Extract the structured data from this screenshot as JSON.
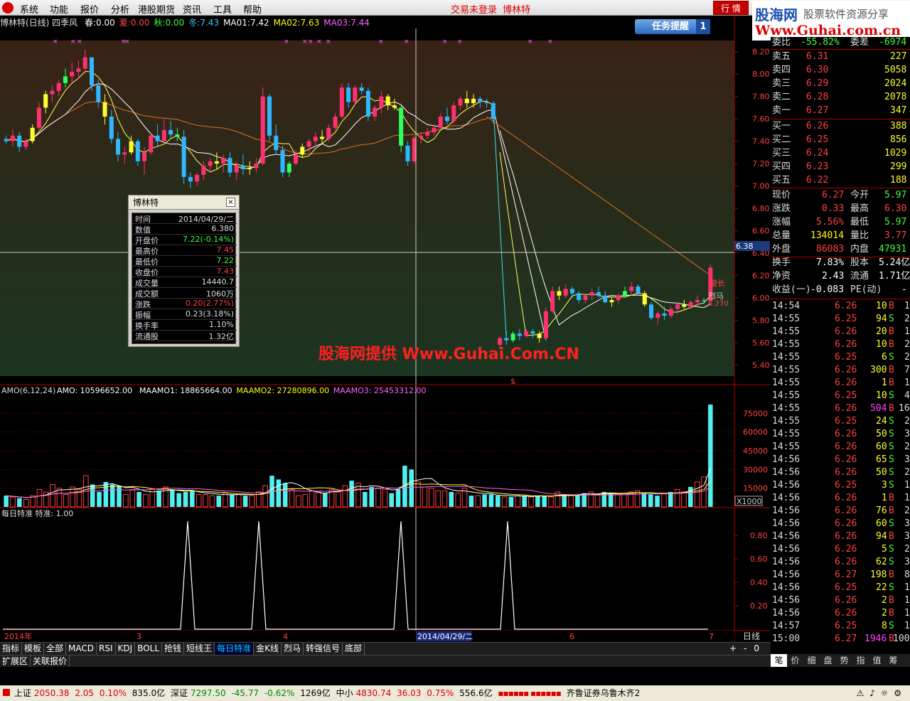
{
  "menubar": {
    "items": [
      "系统",
      "功能",
      "报价",
      "分析",
      "港股期货",
      "资讯",
      "工具",
      "帮助"
    ],
    "trade_status": "交易未登录",
    "stock_name": "博林特",
    "quote_button": "行 情"
  },
  "ad": {
    "site_cn": "股海网",
    "tagline": "股票软件资源分享",
    "url": "Www.Guhai.com.cn"
  },
  "watermark": "股海网提供 Www.Guhai.Com.CN",
  "header": {
    "title": "博林特(日线) 四季风",
    "items": [
      {
        "label": "春:",
        "value": "0.00",
        "color": "#ffffff"
      },
      {
        "label": "夏:",
        "value": "0.00",
        "color": "#ff4040"
      },
      {
        "label": "秋:",
        "value": "0.00",
        "color": "#40ff40"
      },
      {
        "label": "冬:",
        "value": "7.43",
        "color": "#40c0ff"
      },
      {
        "label": "MA01:",
        "value": "7.42",
        "color": "#ffffff"
      },
      {
        "label": "MA02:",
        "value": "7.63",
        "color": "#ffff00"
      },
      {
        "label": "MA03:",
        "value": "7.44",
        "color": "#ff60ff"
      }
    ],
    "task_button": "任务提醒",
    "task_count": "1"
  },
  "price_axis": [
    "8.20",
    "8.00",
    "7.80",
    "7.60",
    "7.40",
    "7.20",
    "7.00",
    "6.80",
    "6.60",
    "6.40",
    "6.20",
    "6.00",
    "5.80",
    "5.60",
    "5.40"
  ],
  "crosshair_price": "6.38",
  "annotations": {
    "label1": "增长",
    "label2": "烈马",
    "label3": "6.270"
  },
  "popup": {
    "title": "博林特",
    "close": "×",
    "rows": [
      {
        "k": "时间",
        "v": "2014/04/29/二",
        "c": "#ddd"
      },
      {
        "k": "数值",
        "v": "6.380",
        "c": "#ddd"
      },
      {
        "k": "开盘价",
        "v": "7.22(-0.14%)",
        "c": "#40ff40"
      },
      {
        "k": "最高价",
        "v": "7.45",
        "c": "#ff4040"
      },
      {
        "k": "最低价",
        "v": "7.22",
        "c": "#40ff40"
      },
      {
        "k": "收盘价",
        "v": "7.43",
        "c": "#ff4040"
      },
      {
        "k": "成交量",
        "v": "14440.7",
        "c": "#ddd"
      },
      {
        "k": "成交额",
        "v": "1060万",
        "c": "#ddd"
      },
      {
        "k": "涨跌",
        "v": "0.20(2.77%)",
        "c": "#ff4040"
      },
      {
        "k": "振幅",
        "v": "0.23(3.18%)",
        "c": "#ddd"
      },
      {
        "k": "换手率",
        "v": "1.10%",
        "c": "#ddd"
      },
      {
        "k": "流通股",
        "v": "1.32亿",
        "c": "#ddd"
      }
    ]
  },
  "amo": {
    "title": "AMO(6,12,24)",
    "items": [
      {
        "label": "AMO:",
        "value": "10596652.00",
        "color": "#ffffff"
      },
      {
        "label": "MAAMO1:",
        "value": "18865664.00",
        "color": "#ffffff"
      },
      {
        "label": "MAAMO2:",
        "value": "27280896.00",
        "color": "#ffff00"
      },
      {
        "label": "MAAMO3:",
        "value": "25453312.00",
        "color": "#ff60ff"
      }
    ],
    "axis": [
      "75000",
      "60000",
      "45000",
      "30000",
      "15000"
    ],
    "unit": "X1000"
  },
  "daily": {
    "title": "每日特准",
    "label": "特准:",
    "value": "1.00",
    "axis": [
      "0.80",
      "0.60",
      "0.40",
      "0.20"
    ]
  },
  "date_axis": {
    "items": [
      "2014年",
      "3",
      "4",
      "2014/04/29/二",
      "6",
      "7"
    ],
    "right_label": "日线"
  },
  "order_book": {
    "wb_label": "委比",
    "wb_value": "-55.82%",
    "wc_label": "委差",
    "wc_value": "-6974",
    "sells": [
      {
        "label": "卖五",
        "price": "6.31",
        "vol": "227"
      },
      {
        "label": "卖四",
        "price": "6.30",
        "vol": "5058"
      },
      {
        "label": "卖三",
        "price": "6.29",
        "vol": "2024"
      },
      {
        "label": "卖二",
        "price": "6.28",
        "vol": "2078"
      },
      {
        "label": "卖一",
        "price": "6.27",
        "vol": "347"
      }
    ],
    "buys": [
      {
        "label": "买一",
        "price": "6.26",
        "vol": "388"
      },
      {
        "label": "买二",
        "price": "6.25",
        "vol": "856"
      },
      {
        "label": "买三",
        "price": "6.24",
        "vol": "1029"
      },
      {
        "label": "买四",
        "price": "6.23",
        "vol": "299"
      },
      {
        "label": "买五",
        "price": "6.22",
        "vol": "188"
      }
    ]
  },
  "stats": [
    [
      "现价",
      "6.27",
      "#ff4040",
      "今开",
      "5.97",
      "#40ff40"
    ],
    [
      "涨跌",
      "0.33",
      "#ff4040",
      "最高",
      "6.30",
      "#ff4040"
    ],
    [
      "涨幅",
      "5.56%",
      "#ff4040",
      "最低",
      "5.97",
      "#40ff40"
    ],
    [
      "总量",
      "134014",
      "#ffff00",
      "量比",
      "3.77",
      "#ff4040"
    ],
    [
      "外盘",
      "86083",
      "#ff4040",
      "内盘",
      "47931",
      "#40ff40"
    ],
    [
      "换手",
      "7.83%",
      "#ffffff",
      "股本",
      "5.24亿",
      "#ffffff"
    ],
    [
      "净资",
      "2.43",
      "#ffffff",
      "流通",
      "1.71亿",
      "#ffffff"
    ],
    [
      "收益(一)",
      "-0.083",
      "#ffffff",
      "PE(动)",
      "-",
      "#ffffff"
    ]
  ],
  "ticks": [
    [
      "14:54",
      "6.26",
      "10",
      "B",
      "1"
    ],
    [
      "14:55",
      "6.25",
      "94",
      "S",
      "2"
    ],
    [
      "14:55",
      "6.26",
      "20",
      "B",
      "1"
    ],
    [
      "14:55",
      "6.26",
      "10",
      "B",
      "2"
    ],
    [
      "14:55",
      "6.25",
      "6",
      "S",
      "2"
    ],
    [
      "14:55",
      "6.26",
      "300",
      "B",
      "7"
    ],
    [
      "14:55",
      "6.26",
      "1",
      "B",
      "1"
    ],
    [
      "14:55",
      "6.25",
      "10",
      "S",
      "4"
    ],
    [
      "14:55",
      "6.26",
      "504",
      "B",
      "16"
    ],
    [
      "14:55",
      "6.25",
      "24",
      "S",
      "2"
    ],
    [
      "14:55",
      "6.26",
      "50",
      "S",
      "3"
    ],
    [
      "14:55",
      "6.26",
      "60",
      "S",
      "2"
    ],
    [
      "14:56",
      "6.26",
      "65",
      "S",
      "3"
    ],
    [
      "14:56",
      "6.26",
      "50",
      "S",
      "2"
    ],
    [
      "14:56",
      "6.25",
      "3",
      "S",
      "1"
    ],
    [
      "14:56",
      "6.26",
      "1",
      "B",
      "1"
    ],
    [
      "14:56",
      "6.26",
      "76",
      "B",
      "2"
    ],
    [
      "14:56",
      "6.26",
      "60",
      "S",
      "3"
    ],
    [
      "14:56",
      "6.26",
      "94",
      "B",
      "3"
    ],
    [
      "14:56",
      "6.26",
      "5",
      "S",
      "2"
    ],
    [
      "14:56",
      "6.26",
      "62",
      "S",
      "3"
    ],
    [
      "14:56",
      "6.27",
      "198",
      "B",
      "8"
    ],
    [
      "14:56",
      "6.25",
      "22",
      "S",
      "1"
    ],
    [
      "14:56",
      "6.26",
      "2",
      "B",
      "1"
    ],
    [
      "14:56",
      "6.26",
      "2",
      "B",
      "1"
    ],
    [
      "14:57",
      "6.25",
      "8",
      "S",
      "1"
    ],
    [
      "15:00",
      "6.27",
      "1946",
      "B",
      "100"
    ]
  ],
  "bottom_tabs": [
    "指标",
    "模板",
    "全部",
    "MACD",
    "RSI",
    "KDJ",
    "BOLL",
    "抢钱",
    "短线王",
    "每日特准",
    "金K线",
    "烈马",
    "转强信号",
    "底部"
  ],
  "bottom_tabs2": [
    "扩展区",
    "关联报价"
  ],
  "right_tabs": [
    "笔",
    "价",
    "细",
    "盘",
    "势",
    "指",
    "值",
    "筹"
  ],
  "zoom_controls": [
    "+",
    "-",
    "0"
  ],
  "status": {
    "sh_label": "上证",
    "sh_val": "2050.38",
    "sh_chg": "2.05",
    "sh_pct": "0.10%",
    "sh_amt": "835.0亿",
    "sz_label": "深证",
    "sz_val": "7297.50",
    "sz_chg": "-45.77",
    "sz_pct": "-0.62%",
    "sz_amt": "1269亿",
    "zx_label": "中小",
    "zx_val": "4830.74",
    "zx_chg": "36.03",
    "zx_pct": "0.75%",
    "zx_amt": "556.6亿",
    "broker": "齐鲁证券乌鲁木齐2"
  },
  "chart_data": {
    "type": "candlestick",
    "price_range": [
      5.3,
      8.3
    ],
    "candles": [
      [
        7.42,
        7.45,
        7.38,
        7.4
      ],
      [
        7.4,
        7.5,
        7.35,
        7.45
      ],
      [
        7.45,
        7.48,
        7.3,
        7.35
      ],
      [
        7.35,
        7.42,
        7.32,
        7.4
      ],
      [
        7.4,
        7.55,
        7.38,
        7.52
      ],
      [
        7.52,
        7.75,
        7.5,
        7.7
      ],
      [
        7.7,
        7.85,
        7.65,
        7.82
      ],
      [
        7.82,
        7.9,
        7.75,
        7.85
      ],
      [
        7.85,
        7.95,
        7.8,
        7.92
      ],
      [
        7.92,
        8.05,
        7.88,
        7.98
      ],
      [
        7.98,
        8.1,
        7.92,
        8.02
      ],
      [
        8.02,
        8.12,
        7.96,
        8.05
      ],
      [
        8.05,
        8.22,
        8.0,
        8.15
      ],
      [
        8.15,
        8.15,
        7.85,
        7.9
      ],
      [
        7.9,
        7.95,
        7.7,
        7.75
      ],
      [
        7.75,
        7.82,
        7.55,
        7.62
      ],
      [
        7.62,
        7.68,
        7.38,
        7.42
      ],
      [
        7.42,
        7.48,
        7.22,
        7.28
      ],
      [
        7.28,
        7.35,
        7.2,
        7.3
      ],
      [
        7.3,
        7.45,
        7.28,
        7.4
      ],
      [
        7.4,
        7.42,
        7.18,
        7.22
      ],
      [
        7.22,
        7.35,
        7.1,
        7.3
      ],
      [
        7.3,
        7.48,
        7.28,
        7.45
      ],
      [
        7.45,
        7.55,
        7.35,
        7.4
      ],
      [
        7.4,
        7.6,
        7.38,
        7.5
      ],
      [
        7.5,
        7.58,
        7.42,
        7.46
      ],
      [
        7.46,
        7.52,
        7.4,
        7.44
      ],
      [
        7.44,
        7.5,
        7.02,
        7.08
      ],
      [
        7.08,
        7.12,
        6.98,
        7.04
      ],
      [
        7.04,
        7.12,
        7.0,
        7.1
      ],
      [
        7.1,
        7.22,
        7.05,
        7.18
      ],
      [
        7.18,
        7.25,
        7.12,
        7.22
      ],
      [
        7.22,
        7.3,
        7.15,
        7.2
      ],
      [
        7.2,
        7.28,
        7.12,
        7.25
      ],
      [
        7.25,
        7.3,
        7.08,
        7.12
      ],
      [
        7.12,
        7.22,
        7.05,
        7.18
      ],
      [
        7.18,
        7.28,
        7.1,
        7.15
      ],
      [
        7.15,
        7.22,
        7.1,
        7.16
      ],
      [
        7.16,
        7.25,
        7.12,
        7.2
      ],
      [
        7.2,
        7.88,
        7.18,
        7.8
      ],
      [
        7.8,
        7.82,
        7.4,
        7.45
      ],
      [
        7.45,
        7.55,
        7.28,
        7.32
      ],
      [
        7.32,
        7.36,
        7.08,
        7.12
      ],
      [
        7.12,
        7.22,
        7.08,
        7.2
      ],
      [
        7.2,
        7.32,
        7.18,
        7.28
      ],
      [
        7.28,
        7.38,
        7.25,
        7.35
      ],
      [
        7.35,
        7.42,
        7.3,
        7.4
      ],
      [
        7.4,
        7.48,
        7.35,
        7.44
      ],
      [
        7.44,
        7.5,
        7.38,
        7.42
      ],
      [
        7.42,
        7.55,
        7.4,
        7.52
      ],
      [
        7.52,
        7.65,
        7.5,
        7.62
      ],
      [
        7.62,
        7.92,
        7.6,
        7.88
      ],
      [
        7.88,
        7.92,
        7.7,
        7.75
      ],
      [
        7.75,
        7.9,
        7.72,
        7.88
      ],
      [
        7.88,
        7.92,
        7.82,
        7.85
      ],
      [
        7.85,
        7.88,
        7.58,
        7.62
      ],
      [
        7.62,
        7.72,
        7.58,
        7.7
      ],
      [
        7.7,
        7.85,
        7.65,
        7.8
      ],
      [
        7.8,
        7.82,
        7.68,
        7.72
      ],
      [
        7.72,
        7.78,
        7.68,
        7.7
      ],
      [
        7.7,
        7.72,
        7.3,
        7.36
      ],
      [
        7.36,
        7.4,
        7.18,
        7.22
      ],
      [
        7.22,
        7.45,
        7.2,
        7.43
      ],
      [
        7.43,
        7.48,
        7.38,
        7.45
      ],
      [
        7.45,
        7.52,
        7.42,
        7.48
      ],
      [
        7.48,
        7.55,
        7.45,
        7.52
      ],
      [
        7.52,
        7.65,
        7.5,
        7.62
      ],
      [
        7.62,
        7.7,
        7.55,
        7.58
      ],
      [
        7.58,
        7.75,
        7.56,
        7.72
      ],
      [
        7.72,
        7.8,
        7.68,
        7.78
      ],
      [
        7.78,
        7.85,
        7.7,
        7.74
      ],
      [
        7.74,
        7.82,
        7.7,
        7.78
      ],
      [
        7.78,
        7.8,
        7.7,
        7.75
      ],
      [
        7.75,
        7.78,
        7.7,
        7.74
      ],
      [
        7.74,
        7.76,
        7.56,
        7.6
      ],
      [
        5.58,
        5.66,
        5.54,
        5.64
      ],
      [
        5.64,
        5.7,
        5.58,
        5.62
      ],
      [
        5.62,
        5.7,
        5.6,
        5.68
      ],
      [
        5.68,
        5.72,
        5.62,
        5.66
      ],
      [
        5.66,
        5.72,
        5.64,
        5.7
      ],
      [
        5.7,
        5.72,
        5.64,
        5.68
      ],
      [
        5.68,
        5.7,
        5.6,
        5.64
      ],
      [
        5.64,
        5.92,
        5.62,
        5.88
      ],
      [
        5.88,
        6.1,
        5.86,
        6.06
      ],
      [
        6.06,
        6.1,
        5.98,
        6.02
      ],
      [
        6.02,
        6.12,
        6.0,
        6.08
      ],
      [
        6.08,
        6.1,
        6.0,
        6.04
      ],
      [
        6.04,
        6.06,
        5.95,
        5.98
      ],
      [
        5.98,
        6.04,
        5.95,
        6.02
      ],
      [
        6.02,
        6.08,
        5.98,
        6.05
      ],
      [
        6.05,
        6.1,
        6.0,
        6.02
      ],
      [
        6.02,
        6.06,
        5.95,
        5.96
      ],
      [
        5.96,
        6.0,
        5.92,
        5.98
      ],
      [
        5.98,
        6.04,
        5.95,
        6.02
      ],
      [
        6.02,
        6.1,
        6.0,
        6.06
      ],
      [
        6.06,
        6.14,
        6.02,
        6.1
      ],
      [
        6.1,
        6.12,
        6.02,
        6.04
      ],
      [
        6.04,
        6.06,
        5.92,
        5.94
      ],
      [
        5.94,
        5.96,
        5.8,
        5.82
      ],
      [
        5.82,
        5.88,
        5.76,
        5.86
      ],
      [
        5.86,
        5.92,
        5.8,
        5.84
      ],
      [
        5.84,
        5.92,
        5.82,
        5.9
      ],
      [
        5.9,
        5.96,
        5.86,
        5.94
      ],
      [
        5.94,
        5.98,
        5.9,
        5.92
      ],
      [
        5.92,
        5.98,
        5.9,
        5.96
      ],
      [
        5.96,
        6.02,
        5.92,
        5.98
      ],
      [
        5.98,
        6.0,
        5.94,
        5.97
      ],
      [
        5.97,
        6.3,
        5.97,
        6.27
      ]
    ],
    "amo_values_x1000": [
      9000,
      8000,
      7000,
      6000,
      9000,
      14000,
      12000,
      18000,
      15000,
      10000,
      16000,
      14000,
      25000,
      18000,
      12000,
      20000,
      18000,
      17000,
      10000,
      14000,
      12000,
      10000,
      14000,
      13000,
      16000,
      14000,
      11000,
      12000,
      13000,
      10000,
      10000,
      9000,
      9000,
      11000,
      10000,
      10000,
      9000,
      9000,
      12000,
      17000,
      25000,
      22000,
      19000,
      14000,
      9000,
      10000,
      13000,
      12000,
      11000,
      14000,
      12000,
      17000,
      21000,
      19000,
      12000,
      16000,
      15000,
      14000,
      11000,
      14000,
      33000,
      30000,
      20000,
      16000,
      15000,
      13000,
      13000,
      12000,
      11000,
      15000,
      9000,
      9000,
      10000,
      10000,
      9000,
      8000,
      8000,
      9000,
      9000,
      8000,
      9000,
      9000,
      8000,
      12000,
      10000,
      9000,
      10000,
      11000,
      12000,
      10000,
      12000,
      11000,
      10000,
      11000,
      12000,
      13000,
      11000,
      10000,
      9000,
      11000,
      12000,
      14000,
      12000,
      16000,
      20000,
      24000,
      82000
    ],
    "signal_peaks": [
      0.26,
      0.36,
      0.56,
      0.71
    ]
  }
}
